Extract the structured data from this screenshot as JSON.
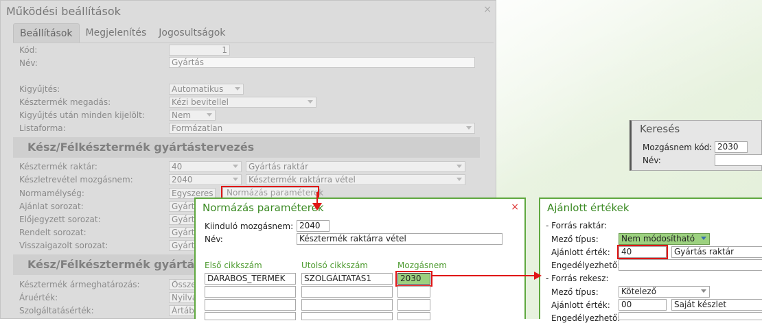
{
  "main": {
    "title": "Működési beállítások",
    "close": "×",
    "tabs": [
      "Beállítások",
      "Megjelenítés",
      "Jogosultságok"
    ],
    "kod_label": "Kód:",
    "kod_value": "1",
    "nev_label": "Név:",
    "nev_value": "Gyártás",
    "kigyujtes_label": "Kigyűjtés:",
    "kigyujtes_value": "Automatikus",
    "keszmegadas_label": "Késztermék megadás:",
    "keszmegadas_value": "Kézi bevitellel",
    "kigyujtes_utan_label": "Kigyűjtés után minden kijelölt:",
    "kigyujtes_utan_value": "Nem",
    "listaforma_label": "Listaforma:",
    "listaforma_value": "Formázatlan",
    "section1": "Kész/Félkésztermék gyártástervezés",
    "raktar_label": "Késztermék raktár:",
    "raktar_code": "40",
    "raktar_name": "Gyártás raktár",
    "mozgasnem_label": "Készletrevétel mozgásnem:",
    "mozgasnem_code": "2040",
    "mozgasnem_name": "Késztermék raktárra vétel",
    "normamelyseg_label": "Normamélység:",
    "normamelyseg_value": "Egyszeres",
    "normazas_button": "Normázás paraméterek",
    "ajanlat_label": "Ajánlat sorozat:",
    "ajanlat_value": "Gyárt",
    "elojegyzett_label": "Előjegyzett sorozat:",
    "elojegyzett_value": "Gyárt",
    "rendelt_label": "Rendelt sorozat:",
    "rendelt_value": "Gyárt",
    "visszaigazolt_label": "Visszaigazolt sorozat:",
    "visszaigazolt_value": "Gyárt",
    "section2": "Kész/Félkésztermék gyártás",
    "armeg_label": "Késztermék ármeghatározás:",
    "armeg_value": "Össze",
    "aruertek_label": "Áruérték:",
    "aruertek_value": "Nyilvá",
    "szolg_label": "Szolgáltatásérték:",
    "szolg_value": "Ártábl"
  },
  "normazas": {
    "title": "Normázás paraméterek",
    "close": "×",
    "kiindulo_label": "Kiinduló mozgásnem:",
    "kiindulo_value": "2040",
    "nev_label": "Név:",
    "nev_value": "Késztermék raktárra vétel",
    "col_elso": "Első cikkszám",
    "col_utolso": "Utolsó cikkszám",
    "col_mozgas": "Mozgásnem",
    "row1_elso": "DARABOS_TERMÉK",
    "row1_utolso": "SZOLGÁLTATÁS1",
    "row1_mozgas": "2030"
  },
  "ajanlott": {
    "title": "Ajánlott értékek",
    "forras_raktar": "- Forrás raktár:",
    "mezo_tipus_label": "Mező típus:",
    "mezo_tipus_value": "Nem módosítható",
    "ajanlott_ertek_label": "Ajánlott érték:",
    "ajanlott_ertek_code": "40",
    "ajanlott_ertek_name": "Gyártás raktár",
    "engedelyezheto_label": "Engedélyezhető:",
    "forras_rekesz": "- Forrás rekesz:",
    "mezo_tipus2_value": "Kötelező",
    "ajanlott_ertek2_code": "00",
    "ajanlott_ertek2_name": "Saját készlet",
    "engedelyezheto2_label": "Engedélyezhető:"
  },
  "kereses": {
    "title": "Keresés",
    "mozgasnem_label": "Mozgásnem kód:",
    "mozgasnem_value": "2030",
    "nev_label": "Név:"
  },
  "colors": {
    "green_border": "#5fa83f",
    "green_title": "#3b8a24",
    "highlight": "#e01616",
    "selected_fill": "#9cd17f"
  },
  "icons": [
    "close-icon",
    "chevron-down-icon"
  ]
}
